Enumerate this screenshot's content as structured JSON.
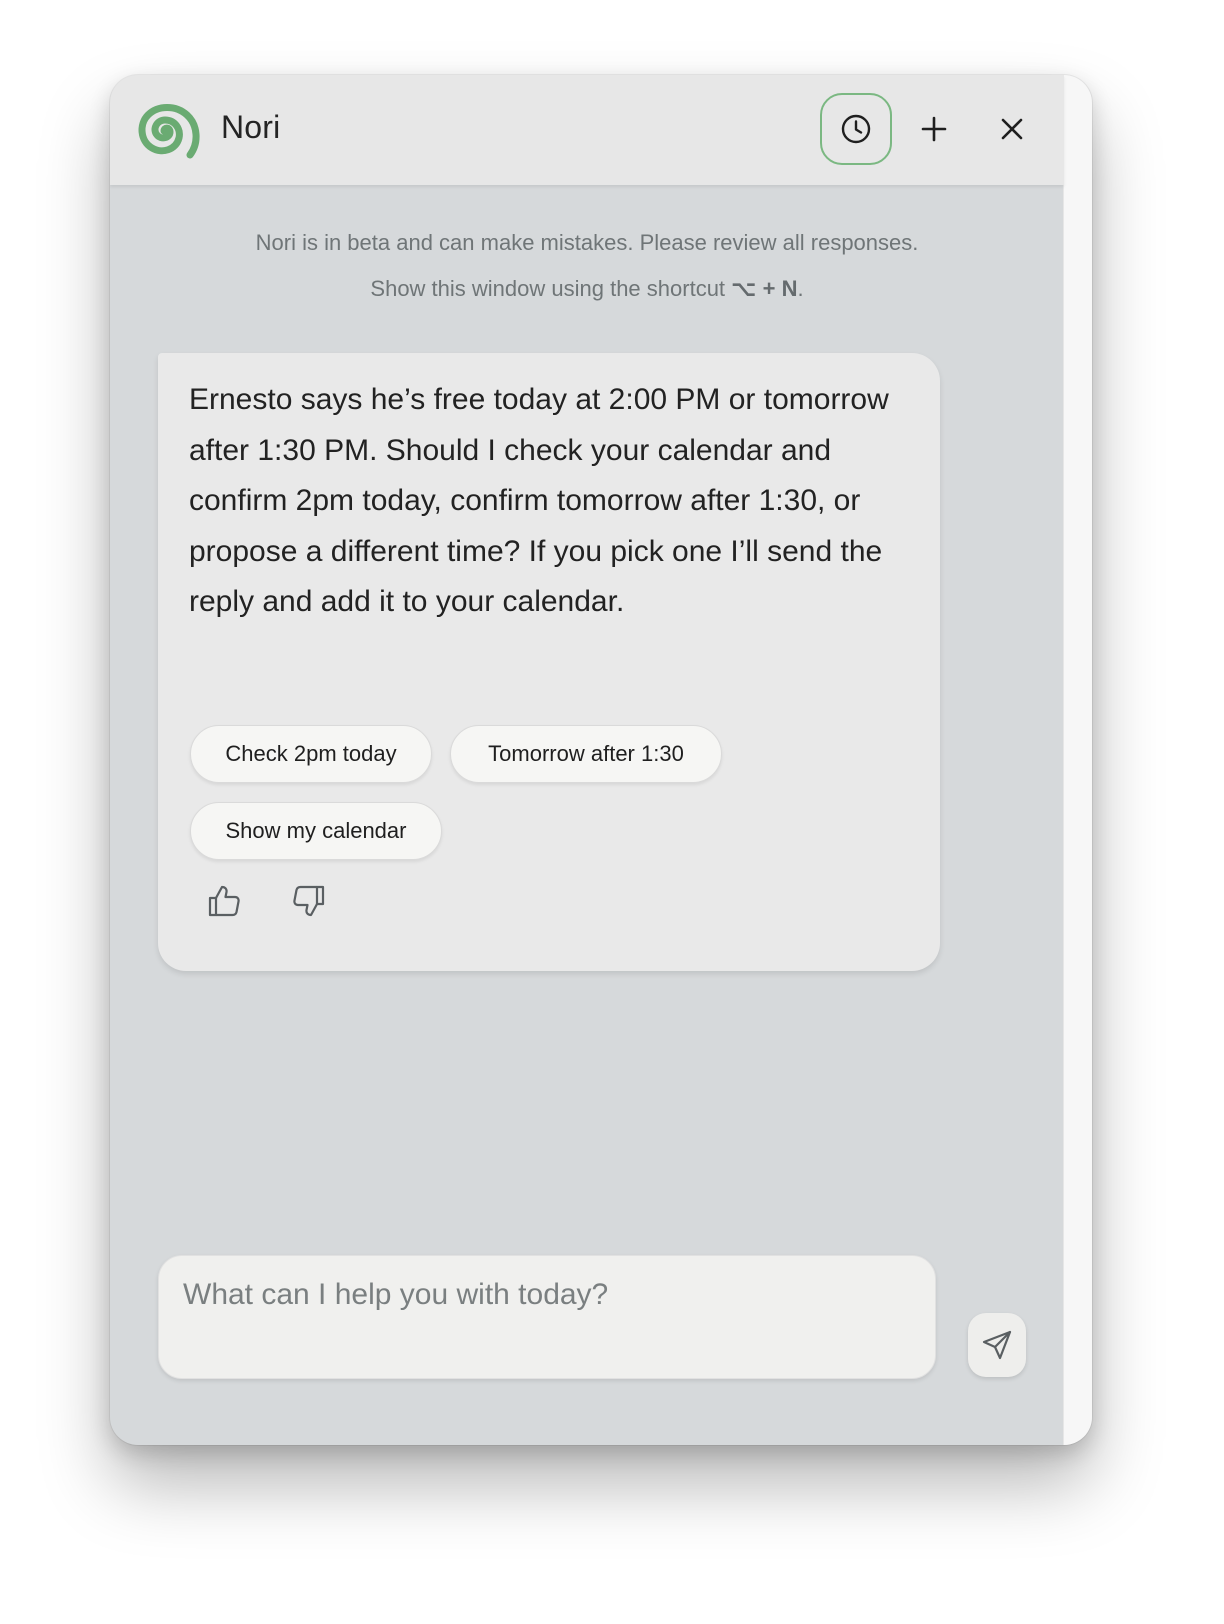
{
  "app": {
    "title": "Nori",
    "brand_color": "#6aab72"
  },
  "titlebar": {
    "history_icon": "clock-icon",
    "new_icon": "plus-icon",
    "close_icon": "close-icon"
  },
  "notices": {
    "beta": "Nori is in beta and can make mistakes. Please review all responses.",
    "shortcut_prefix": "Show this window using the shortcut ",
    "shortcut_key": "⌥ + N",
    "shortcut_suffix": "."
  },
  "message": {
    "text": "Ernesto says he’s free today at 2:00 PM or tomorrow after 1:30 PM. Should I check your calendar and confirm 2pm today, confirm tomorrow after 1:30, or propose a different time? If you pick one I’ll send the reply and add it to your calendar.",
    "chips": [
      "Check 2pm today",
      "Tomorrow after 1:30",
      "Show my calendar"
    ],
    "feedback_icons": [
      "thumbs-up-icon",
      "thumbs-down-icon"
    ]
  },
  "composer": {
    "placeholder": "What can I help you with today?",
    "value": "",
    "send_icon": "send-icon"
  }
}
